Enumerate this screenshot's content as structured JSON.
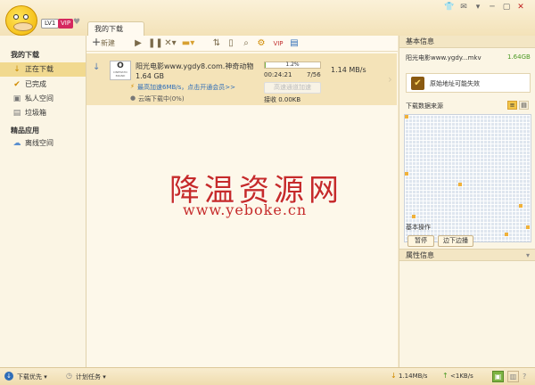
{
  "user": {
    "level": "LV1",
    "vip": "VIP"
  },
  "window": {
    "icons": [
      "skin-icon",
      "feedback-icon",
      "menu-icon",
      "minimize-icon",
      "maximize-icon",
      "close-icon"
    ]
  },
  "tab": {
    "label": "我的下载"
  },
  "sidebar": {
    "section1": "我的下载",
    "items1": [
      {
        "label": "正在下载",
        "icon": "download-arrow-icon",
        "active": true
      },
      {
        "label": "已完成",
        "icon": "check-icon",
        "active": false
      },
      {
        "label": "私人空间",
        "icon": "lock-icon",
        "active": false
      },
      {
        "label": "垃圾箱",
        "icon": "trash-icon",
        "active": false
      }
    ],
    "section2": "精品应用",
    "items2": [
      {
        "label": "离线空间",
        "icon": "cloud-icon"
      }
    ]
  },
  "toolbar": {
    "new_label": "新建"
  },
  "download": {
    "name": "阳光电影www.ygdy8.com.神奇动物：格...",
    "size": "1.64 GB",
    "progress_percent": 1.2,
    "progress_text": "1.2%",
    "elapsed": "00:24:21",
    "parts": "7/56",
    "speed": "1.14 MB/s",
    "accel_text": "最高加速6MB/s，点击开通会员>>",
    "cloud_text": "云端下载中(0%)",
    "recv_text": "接收 0.00KB",
    "accel_btn": "高速通道加速",
    "logo_text": "CINEMATIC BRAND"
  },
  "right": {
    "basic_info_title": "基本信息",
    "file_name": "阳光电影www.ygdy...mkv",
    "file_size": "1.64GB",
    "warning": "原始地址可能失效",
    "sources_title": "下载数据来源",
    "ops_title": "基本操作",
    "pause_btn": "暂停",
    "play_btn": "边下边播",
    "attr_title": "属性信息"
  },
  "status": {
    "download_priority": "下载优先",
    "schedule": "计划任务",
    "down_speed": "1.14MB/s",
    "up_speed": "<1KB/s"
  },
  "watermark": {
    "title": "降温资源网",
    "url": "www.yeboke.cn"
  }
}
